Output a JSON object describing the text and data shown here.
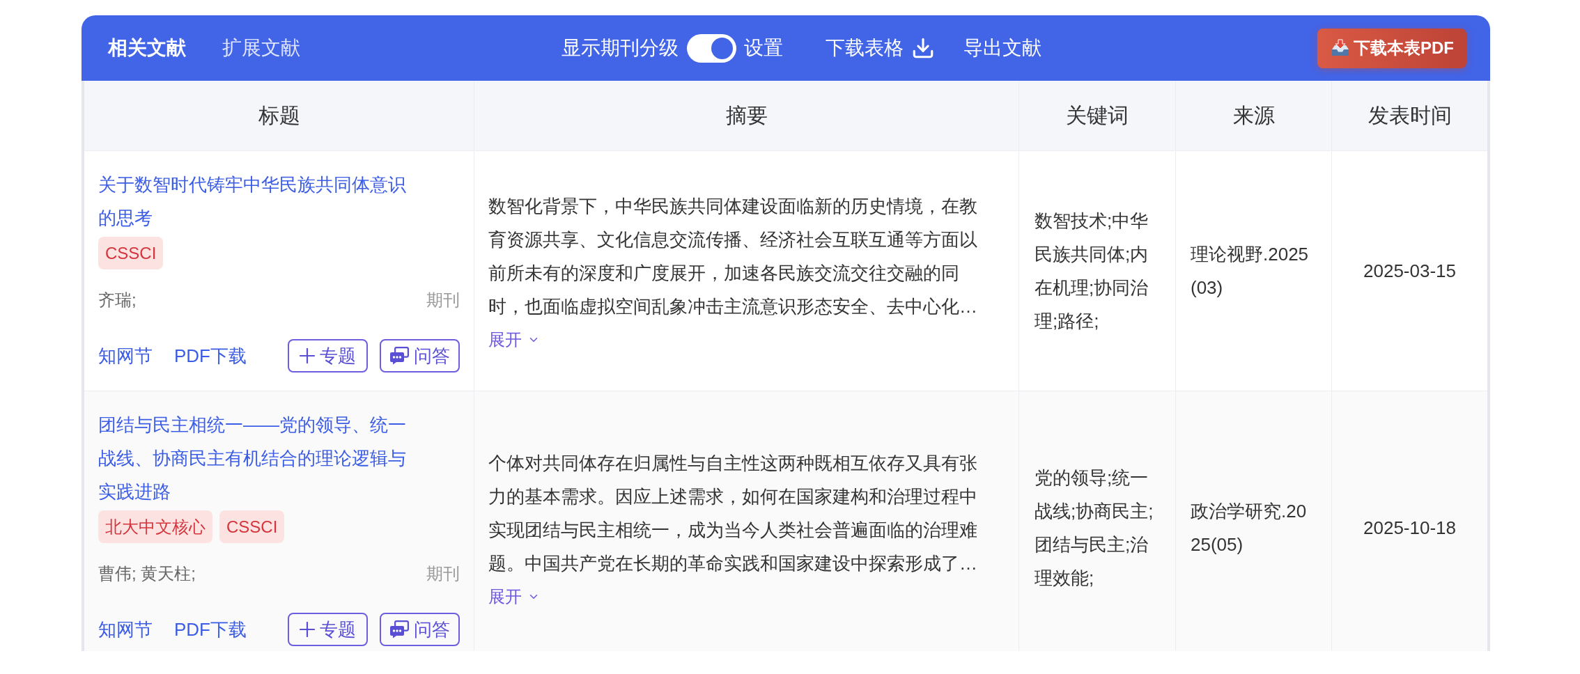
{
  "header": {
    "tabs": [
      {
        "label": "相关文献",
        "selected": true
      },
      {
        "label": "扩展文献",
        "selected": false
      }
    ],
    "journal_rank_toggle": {
      "label": "显示期刊分级",
      "on": true
    },
    "settings_link": "设置",
    "download_table_button": "下载表格",
    "export_button": "导出文献",
    "download_pdf_button": "下载本表PDF"
  },
  "table": {
    "columns": [
      "标题",
      "摘要",
      "关键词",
      "来源",
      "发表时间"
    ],
    "rows": [
      {
        "title": "关于数智时代铸牢中华民族共同体意识的思考",
        "tags": [
          "CSSCI"
        ],
        "authors": "齐瑞;",
        "type": "期刊",
        "links": [
          "知网节",
          "PDF下载"
        ],
        "actions": [
          {
            "kind": "add",
            "label": "专题"
          },
          {
            "kind": "chat",
            "label": "问答"
          }
        ],
        "abstract": "数智化背景下，中华民族共同体建设面临新的历史情境，在教育资源共享、文化信息交流传播、经济社会互联互通等方面以前所未有的深度和广度展开，加速各民族交流交往交融的同时，也面临虚拟空间乱象冲击主流意识形态安全、去中心化…",
        "expand": "展开",
        "keywords": "数智技术;中华民族共同体;内在机理;协同治理;路径;",
        "source": "理论视野.2025(03)",
        "date": "2025-03-15"
      },
      {
        "title": "团结与民主相统一——党的领导、统一战线、协商民主有机结合的理论逻辑与实践进路",
        "tags": [
          "北大中文核心",
          "CSSCI"
        ],
        "authors": "曹伟; 黄天柱;",
        "type": "期刊",
        "links": [
          "知网节",
          "PDF下载"
        ],
        "actions": [
          {
            "kind": "add",
            "label": "专题"
          },
          {
            "kind": "chat",
            "label": "问答"
          }
        ],
        "abstract": "个体对共同体存在归属性与自主性这两种既相互依存又具有张力的基本需求。因应上述需求，如何在国家建构和治理过程中实现团结与民主相统一，成为当今人类社会普遍面临的治理难题。中国共产党在长期的革命实践和国家建设中探索形成了…",
        "expand": "展开",
        "keywords": "党的领导;统一战线;协商民主;团结与民主;治理效能;",
        "source": "政治学研究.2025(05)",
        "date": "2025-10-18"
      }
    ]
  }
}
